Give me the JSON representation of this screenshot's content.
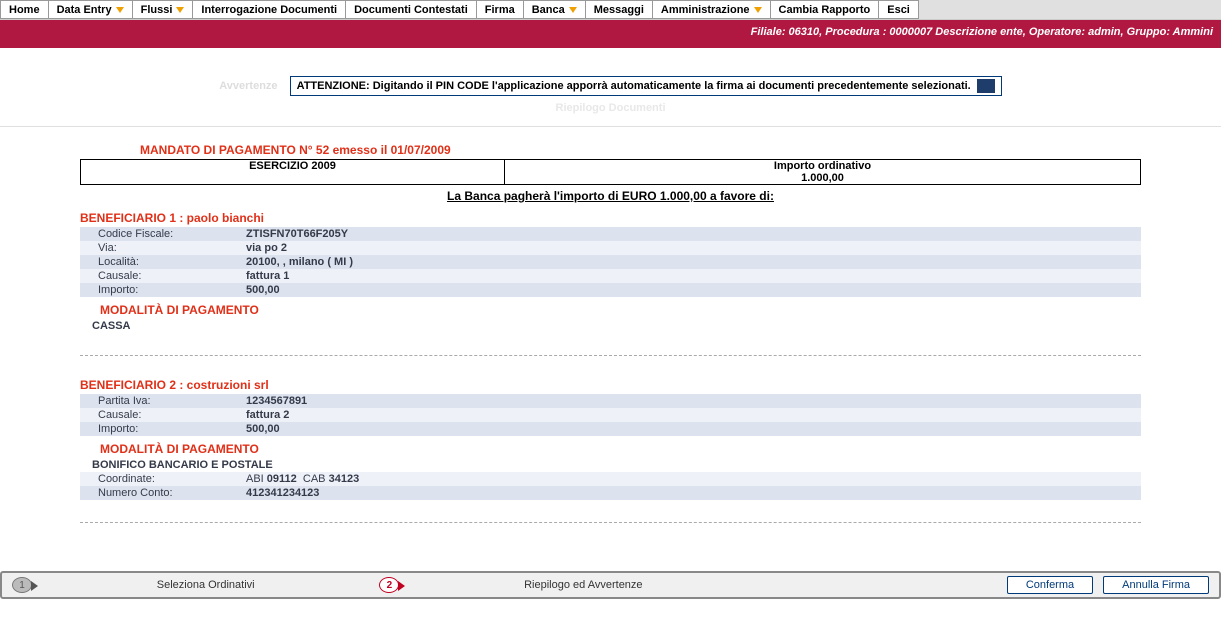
{
  "menu": {
    "items": [
      {
        "label": "Home",
        "dropdown": false
      },
      {
        "label": "Data Entry",
        "dropdown": true
      },
      {
        "label": "Flussi",
        "dropdown": true
      },
      {
        "label": "Interrogazione Documenti",
        "dropdown": false
      },
      {
        "label": "Documenti Contestati",
        "dropdown": false
      },
      {
        "label": "Firma",
        "dropdown": false
      },
      {
        "label": "Banca",
        "dropdown": true
      },
      {
        "label": "Messaggi",
        "dropdown": false
      },
      {
        "label": "Amministrazione",
        "dropdown": true
      },
      {
        "label": "Cambia Rapporto",
        "dropdown": false
      },
      {
        "label": "Esci",
        "dropdown": false
      }
    ]
  },
  "header_status": "Filiale: 06310, Procedura : 0000007 Descrizione ente, Operatore: admin, Gruppo: Ammini",
  "alert": {
    "label": "Avvertenze",
    "text": "ATTENZIONE: Digitando il PIN CODE l'applicazione apporrà automaticamente la firma ai documenti precedentemente selezionati."
  },
  "sub_dim": "Riepilogo Documenti",
  "mandato": {
    "title": "MANDATO DI PAGAMENTO N° 52  emesso il 01/07/2009",
    "esercizio_label": "ESERCIZIO 2009",
    "importo_label": "Importo ordinativo",
    "importo_value": "1.000,00",
    "pay_line": "La Banca pagherà l'importo di EURO 1.000,00 a favore di:"
  },
  "ben1": {
    "header": "BENEFICIARIO 1 :  paolo bianchi",
    "rows": [
      {
        "label": "Codice Fiscale:",
        "value": "ZTISFN70T66F205Y"
      },
      {
        "label": "Via:",
        "value": "via po 2"
      },
      {
        "label": "Località:",
        "value": "20100, , milano   ( MI )"
      },
      {
        "label": "Causale:",
        "value": "fattura 1"
      },
      {
        "label": "Importo:",
        "value": "500,00"
      }
    ],
    "mod_header": "MODALITÀ DI PAGAMENTO",
    "mod_value": "CASSA"
  },
  "ben2": {
    "header": "BENEFICIARIO 2 :  costruzioni srl",
    "rows": [
      {
        "label": "Partita Iva:",
        "value": "1234567891"
      },
      {
        "label": "Causale:",
        "value": "fattura 2"
      },
      {
        "label": "Importo:",
        "value": "500,00"
      }
    ],
    "mod_header": "MODALITÀ DI PAGAMENTO",
    "mod_value": "BONIFICO BANCARIO E POSTALE",
    "extra": [
      {
        "label": "Coordinate:",
        "value_html": "ABI 09112  CAB 34123",
        "abi_lbl": "ABI",
        "abi_val": "09112",
        "cab_lbl": "CAB",
        "cab_val": "34123"
      },
      {
        "label": "Numero Conto:",
        "value": "412341234123"
      }
    ]
  },
  "footer": {
    "step1": "Seleziona Ordinativi",
    "step2": "Riepilogo ed Avvertenze",
    "confirm": "Conferma",
    "cancel": "Annulla Firma",
    "badge1": "1",
    "badge2": "2"
  }
}
